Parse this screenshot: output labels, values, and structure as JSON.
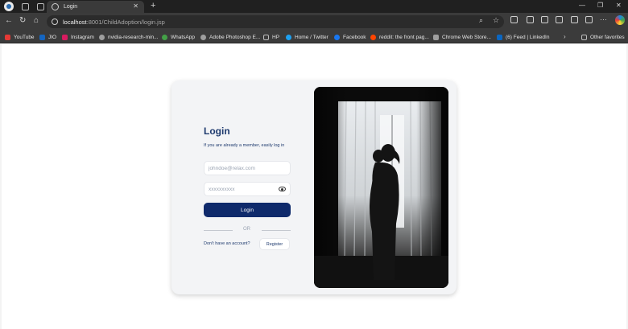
{
  "browser": {
    "tab_title": "Login",
    "url_host": "localhost",
    "url_rest": ":8001/ChildAdoption/login.jsp",
    "bookmarks": [
      {
        "label": "YouTube",
        "color": "#e53935"
      },
      {
        "label": "JIO",
        "color": "#1565c0"
      },
      {
        "label": "Instagram",
        "color": "#d81b60"
      },
      {
        "label": "nvidia-research-min...",
        "color": "#9e9e9e"
      },
      {
        "label": "WhatsApp",
        "color": "#43a047"
      },
      {
        "label": "Adobe Photoshop E...",
        "color": "#9e9e9e"
      },
      {
        "label": "HP",
        "color": "#bdbdbd"
      },
      {
        "label": "Home / Twitter",
        "color": "#1da1f2"
      },
      {
        "label": "Facebook",
        "color": "#1877f2"
      },
      {
        "label": "reddit: the front pag...",
        "color": "#ff4500"
      },
      {
        "label": "Chrome Web Store...",
        "color": "#9e9e9e"
      },
      {
        "label": "(6) Feed | LinkedIn",
        "color": "#0a66c2"
      }
    ],
    "other_favorites": "Other favorites"
  },
  "login": {
    "title": "Login",
    "subtitle": "If you are already a member, easily log in",
    "email_placeholder": "johndoe@relax.com",
    "password_placeholder": "xxxxxxxxxx",
    "login_button": "Login",
    "or_text": "OR",
    "no_account_text": "Don't have an account?",
    "register_button": "Register"
  },
  "colors": {
    "primary": "#0f2a6b",
    "heading": "#1e3a6e",
    "card_bg": "#f3f4f6"
  }
}
